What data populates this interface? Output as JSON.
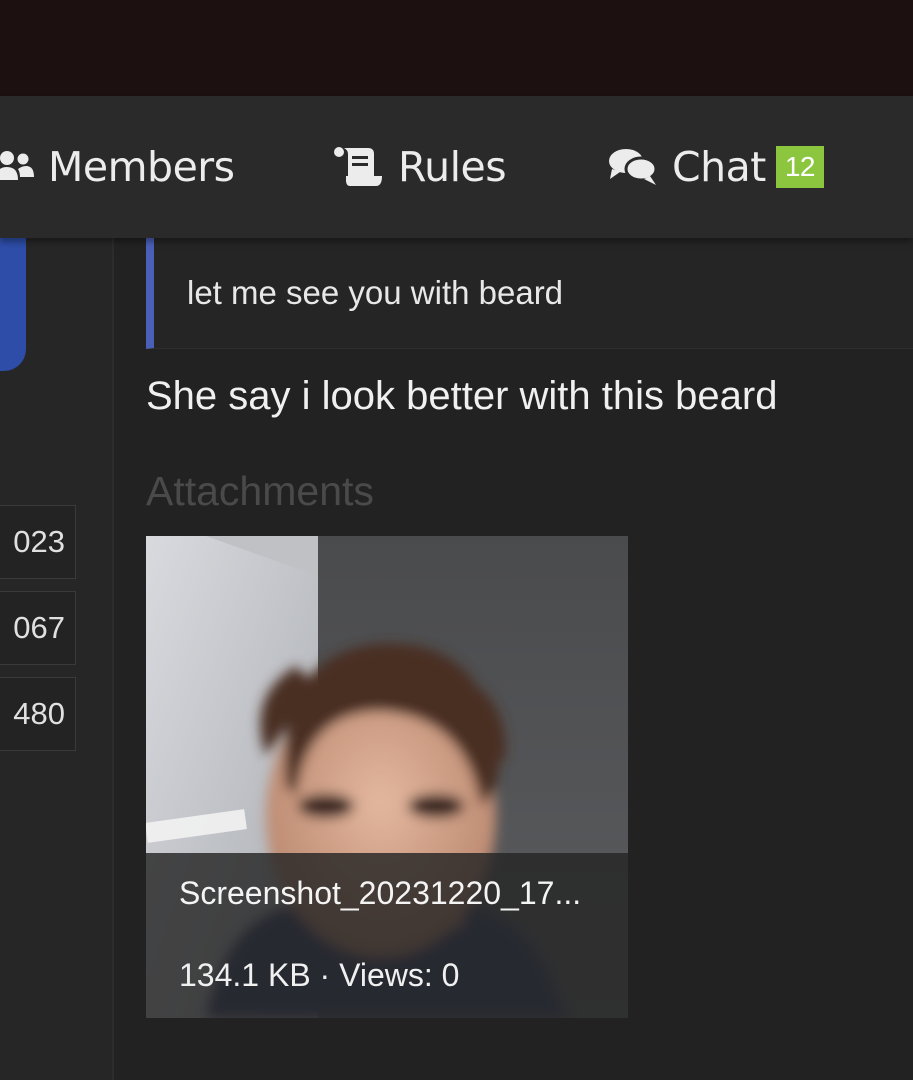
{
  "nav": {
    "members_label": "Members",
    "rules_label": "Rules",
    "chat_label": "Chat",
    "chat_badge": "12",
    "badge_color": "#8cc63f",
    "icons": [
      "users-icon",
      "scroll-icon",
      "comments-icon"
    ]
  },
  "sidebar": {
    "stats": [
      "023",
      "067",
      "480"
    ]
  },
  "post": {
    "quote_text": "let me see you with beard",
    "message": "She say i look better with this beard",
    "attachments_heading": "Attachments",
    "attachment": {
      "filename": "Screenshot_20231220_17...",
      "size": "134.1 KB",
      "separator": "·",
      "views": "Views: 0"
    }
  },
  "colors": {
    "quote_accent": "#4a5fb8",
    "sidebar_accent": "#2e4da8"
  }
}
